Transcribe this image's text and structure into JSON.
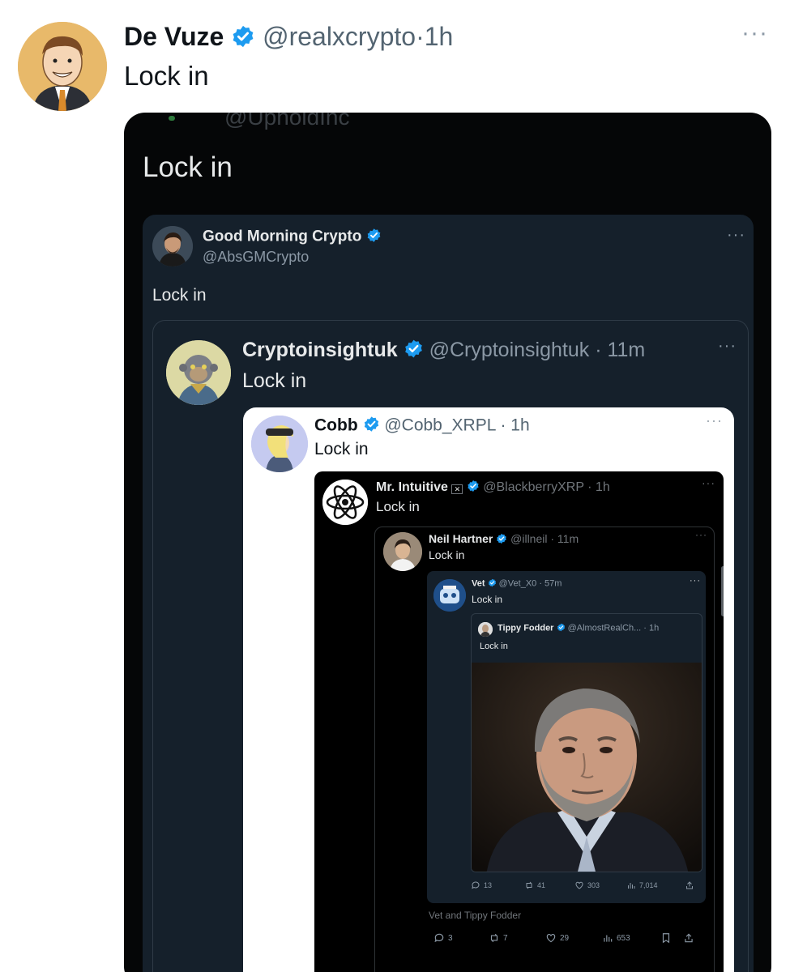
{
  "tweet": {
    "name": "De Vuze",
    "handle": "@realxcrypto",
    "separator": "·",
    "time": "1h",
    "text": "Lock in",
    "more": "···"
  },
  "screenshot": {
    "cut_handle": "@UpholdInc",
    "text": "Lock in",
    "good_morning": {
      "name": "Good Morning Crypto",
      "handle": "@AbsGMCrypto",
      "text": "Lock in",
      "more": "···"
    },
    "cryptoinsight": {
      "name": "Cryptoinsightuk",
      "handle_time": "@Cryptoinsightuk · 11m",
      "text": "Lock in",
      "more": "···"
    },
    "cobb": {
      "name": "Cobb",
      "handle_time": "@Cobb_XRPL · 1h",
      "text": "Lock in",
      "more": "···"
    },
    "mr_intuitive": {
      "name": "Mr. Intuitive",
      "handle_time": "@BlackberryXRP · 1h",
      "text": "Lock in",
      "more": "···"
    },
    "neil": {
      "name": "Neil Hartner",
      "handle_time": "@illneil · 11m",
      "text": "Lock in",
      "more": "···",
      "caption": "Vet and Tippy Fodder",
      "stats": {
        "replies": "3",
        "reposts": "7",
        "likes": "29",
        "views": "653"
      }
    },
    "vet": {
      "name": "Vet",
      "handle_time": "@Vet_X0 · 57m",
      "text": "Lock in",
      "more": "···",
      "stats": {
        "replies": "13",
        "reposts": "41",
        "likes": "303",
        "views": "7,014"
      }
    },
    "tippy": {
      "name": "Tippy Fodder",
      "handle_time": "@AlmostRealCh... · 1h",
      "text": "Lock in"
    }
  },
  "colors": {
    "verified": "#1d9bf0",
    "dark_card": "#15202b",
    "black": "#000000"
  },
  "icons": [
    "verified-badge-icon",
    "reply-icon",
    "repost-icon",
    "like-icon",
    "views-icon",
    "share-icon",
    "bookmark-icon",
    "more-icon"
  ]
}
